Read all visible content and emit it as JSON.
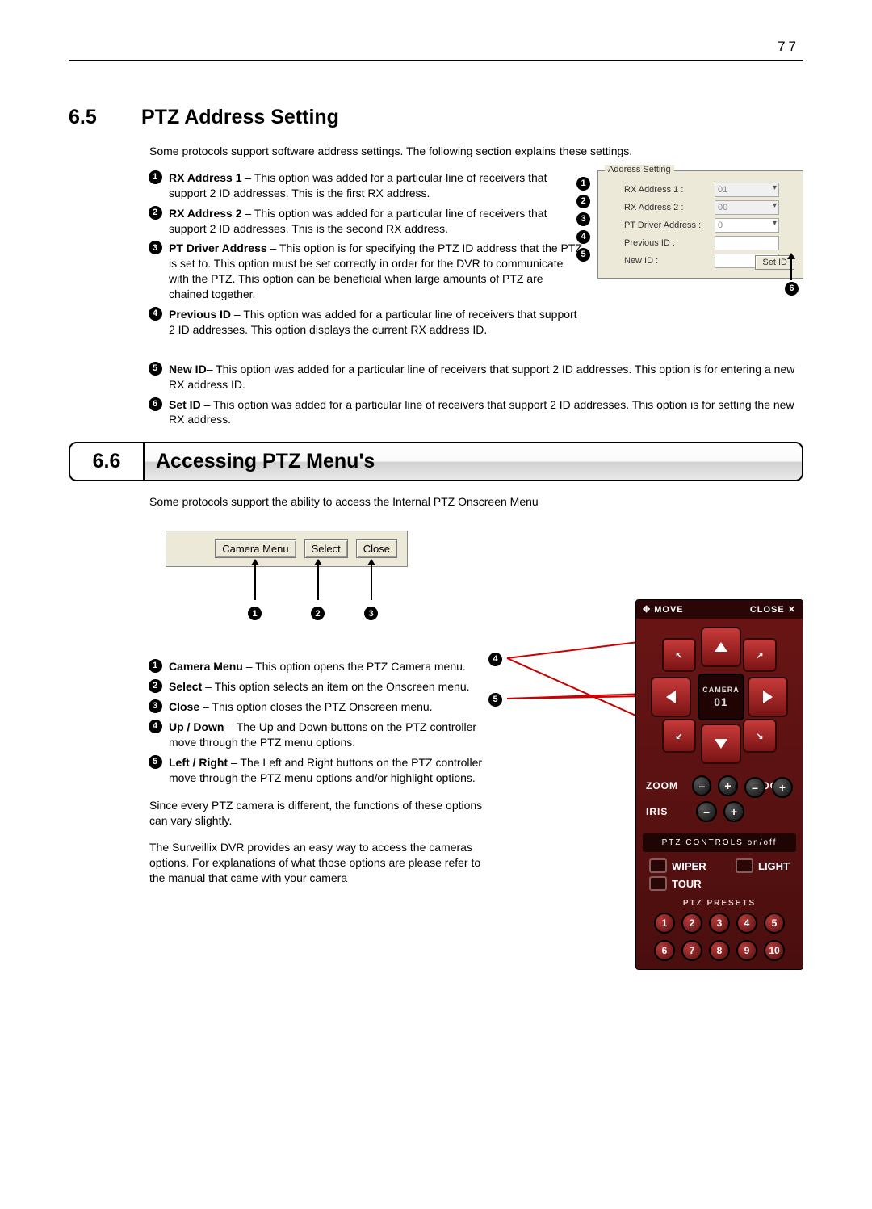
{
  "page_number": "77",
  "section65": {
    "number": "6.5",
    "title": "PTZ Address Setting",
    "intro": "Some protocols support software address settings.  The following section explains these settings.",
    "items": [
      {
        "n": "1",
        "term": "RX Address 1",
        "text": " – This option was added for a particular line of receivers that support 2 ID addresses. This is the first RX address."
      },
      {
        "n": "2",
        "term": "RX Address 2",
        "text": " – This option was added for a particular line of receivers that support 2 ID addresses. This is the second RX address."
      },
      {
        "n": "3",
        "term": "PT Driver Address",
        "text": " – This option is for specifying the PTZ ID address that the PTZ is set to. This option must be set correctly in order for the DVR to communicate with the PTZ. This option can be beneficial when large amounts of PTZ are chained together."
      },
      {
        "n": "4",
        "term": "Previous ID",
        "text": " – This option was added for a particular line of receivers that support 2 ID addresses. This option displays the current RX address ID."
      },
      {
        "n": "5",
        "term": "New ID",
        "text": "– This option was added for a particular line of receivers that support 2 ID addresses. This option is for entering a new RX address ID."
      },
      {
        "n": "6",
        "term": "Set ID",
        "text": " – This option was added for a particular line of receivers that support 2 ID addresses. This option is for setting the new RX address."
      }
    ],
    "groupbox": {
      "title": "Address Setting",
      "rx1_label": "RX Address 1 :",
      "rx1_value": "01",
      "rx2_label": "RX Address 2 :",
      "rx2_value": "00",
      "ptdrv_label": "PT Driver Address  :",
      "ptdrv_value": "0",
      "prev_label": "Previous ID :",
      "new_label": "New ID :",
      "setid_label": "Set ID"
    }
  },
  "section66": {
    "number": "6.6",
    "title": "Accessing PTZ Menu's",
    "intro": "Some protocols support the ability to access the Internal PTZ Onscreen Menu",
    "menu_buttons": {
      "camera_menu": "Camera Menu",
      "select": "Select",
      "close": "Close"
    },
    "items": [
      {
        "n": "1",
        "term": "Camera Menu",
        "text": " – This option opens the PTZ Camera menu."
      },
      {
        "n": "2",
        "term": "Select",
        "text": " – This option selects an item on the Onscreen menu."
      },
      {
        "n": "3",
        "term": "Close",
        "text": " – This option closes the PTZ Onscreen menu."
      },
      {
        "n": "4",
        "term": "Up / Down",
        "text": " – The Up and Down buttons on the PTZ controller move through the PTZ menu options."
      },
      {
        "n": "5",
        "term": "Left / Right",
        "text": " – The Left and Right buttons on the PTZ controller move through the PTZ menu options and/or highlight options."
      }
    ],
    "footer1": "Since every PTZ camera is different, the functions of these options can vary slightly.",
    "footer2": "The Surveillix DVR provides an easy way to access the cameras options. For explanations of what those options are please refer to the manual that came with your camera"
  },
  "ptz_panel": {
    "move": "MOVE",
    "close": "CLOSE",
    "camera_label": "CAMERA",
    "camera_num": "01",
    "zoom": "ZOOM",
    "focus": "FOCUS",
    "iris": "IRIS",
    "controls": "PTZ  CONTROLS   on/off",
    "wiper": "WIPER",
    "light": "LIGHT",
    "tour": "TOUR",
    "presets_title": "PTZ  PRESETS",
    "presets": [
      "1",
      "2",
      "3",
      "4",
      "5",
      "6",
      "7",
      "8",
      "9",
      "10"
    ]
  },
  "callout4": "4",
  "callout5": "5"
}
